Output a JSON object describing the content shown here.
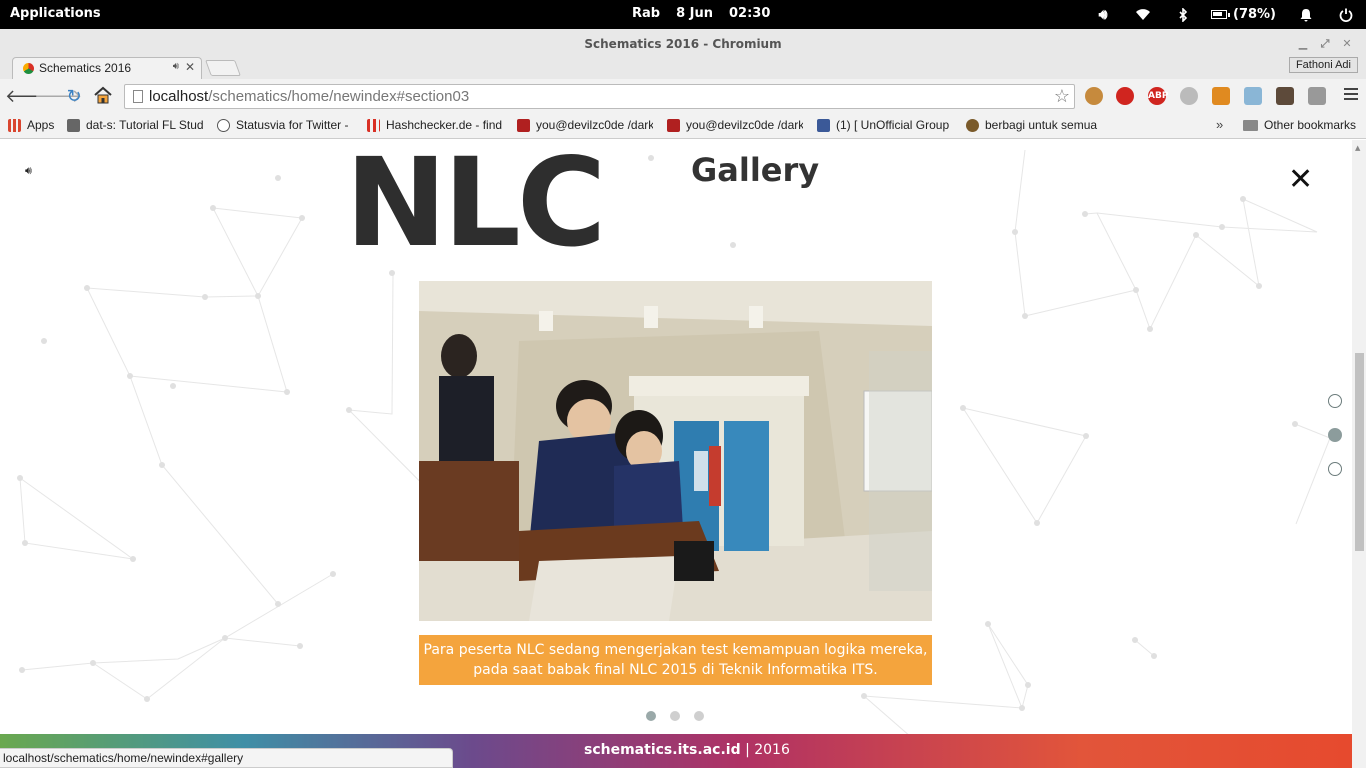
{
  "system": {
    "apps_label": "Applications",
    "day": "Rab",
    "date": "8 Jun",
    "time": "02:30",
    "battery": "(78%)",
    "icons": [
      "volume-icon",
      "wifi-icon",
      "bluetooth-icon",
      "battery-icon",
      "notification-bell-icon",
      "power-icon"
    ]
  },
  "window": {
    "title": "Schematics 2016 - Chromium"
  },
  "tabs": [
    {
      "label": "Schematics 2016"
    }
  ],
  "profile_name": "Fathoni Adi",
  "address": {
    "host": "localhost",
    "path": "/schematics/home/newindex#section03"
  },
  "bookmarks": {
    "items": [
      {
        "label": "Apps",
        "color": "#d9452f"
      },
      {
        "label": "dat-s: Tutorial FL Stud",
        "color": "#666666"
      },
      {
        "label": "Statusvia for Twitter -",
        "color": "#555555"
      },
      {
        "label": "Hashchecker.de - find",
        "color": "#d93025"
      },
      {
        "label": "you@devilzc0de /dark",
        "color": "#b02020"
      },
      {
        "label": "you@devilzc0de /dark",
        "color": "#b02020"
      },
      {
        "label": "(1) [ UnOfficial Group",
        "color": "#3b5998"
      },
      {
        "label": "berbagi untuk semua",
        "color": "#7a5a2a"
      }
    ],
    "more": "»",
    "other": "Other bookmarks"
  },
  "page": {
    "heading_big": "NLC",
    "section_title": "Gallery",
    "close_symbol": "✕",
    "caption": "Para peserta NLC sedang mengerjakan test kemampuan logika mereka, pada saat babak final NLC 2015 di Teknik Informatika ITS.",
    "footer_site": "schematics.its.ac.id",
    "footer_sep": "|",
    "footer_year": "2016",
    "slide_count": 3,
    "active_slide": 1,
    "section_count": 3,
    "active_section": 2
  },
  "status_url": "localhost/schematics/home/newindex#gallery",
  "colors": {
    "caption_bg": "#f4a43d",
    "heading": "#2e2e2e"
  }
}
